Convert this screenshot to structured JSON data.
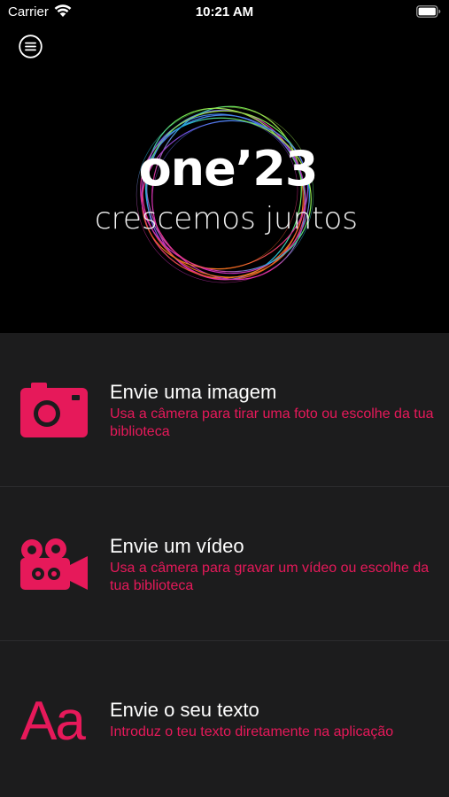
{
  "status_bar": {
    "carrier": "Carrier",
    "time": "10:21 AM"
  },
  "header": {
    "menu_icon": "hamburger-menu-icon",
    "logo_title": "one’23",
    "logo_subtitle": "crescemos juntos"
  },
  "options": [
    {
      "title": "Envie uma imagem",
      "description": "Usa a câmera para tirar uma foto ou escolhe da tua biblioteca",
      "icon": "camera-icon"
    },
    {
      "title": "Envie um vídeo",
      "description": "Usa a câmera para gravar um vídeo ou escolhe da tua biblioteca",
      "icon": "video-camera-icon"
    },
    {
      "title": "Envie o seu texto",
      "description": "Introduz o teu texto diretamente na aplicação",
      "icon": "text-icon",
      "icon_text": "Aa"
    }
  ],
  "colors": {
    "accent": "#e6195a",
    "background": "#000000",
    "list_background": "#1c1c1d"
  }
}
